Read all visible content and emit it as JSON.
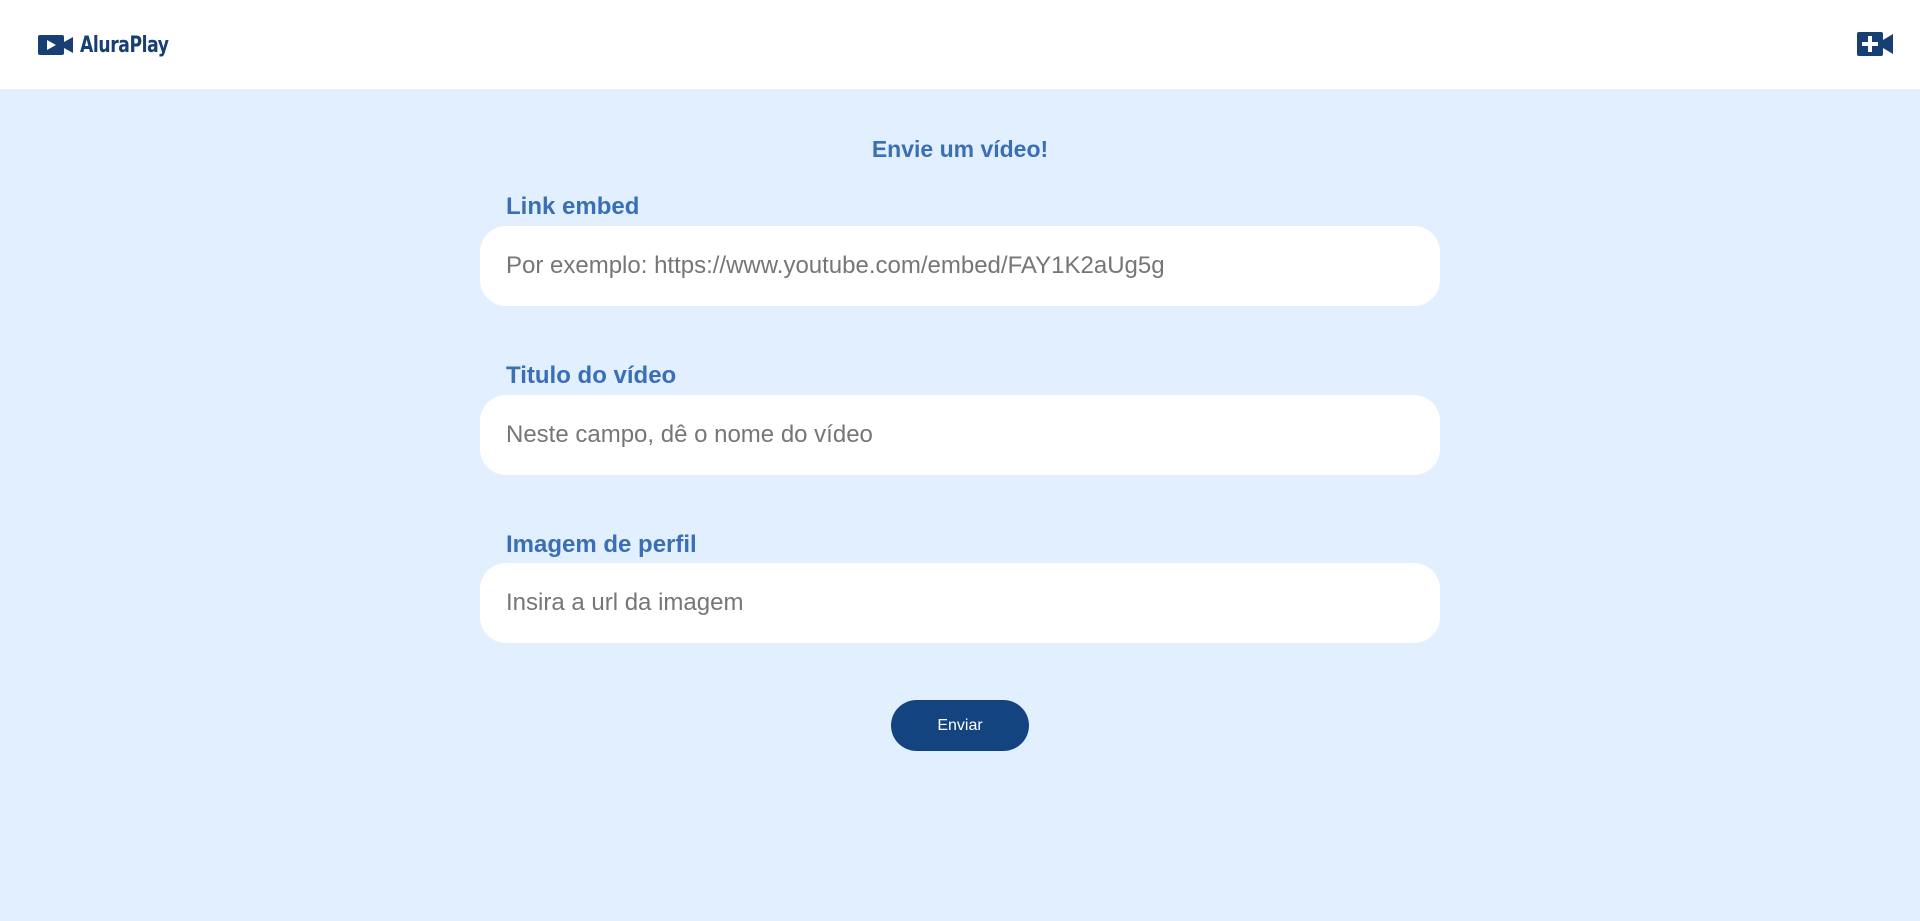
{
  "header": {
    "logo_text": "AluraPlay",
    "add_video_icon": "video-plus-icon"
  },
  "form": {
    "title": "Envie um vídeo!",
    "fields": [
      {
        "label": "Link embed",
        "placeholder": "Por exemplo: https://www.youtube.com/embed/FAY1K2aUg5g",
        "value": ""
      },
      {
        "label": "Titulo do vídeo",
        "placeholder": "Neste campo, dê o nome do vídeo",
        "value": ""
      },
      {
        "label": "Imagem de perfil",
        "placeholder": "Insira a url da imagem",
        "value": ""
      }
    ],
    "submit_label": "Enviar"
  },
  "colors": {
    "background": "#e2effe",
    "header_bg": "#ffffff",
    "accent": "#3b6fb5",
    "brand_dark": "#183f73",
    "button_bg": "#144480"
  }
}
